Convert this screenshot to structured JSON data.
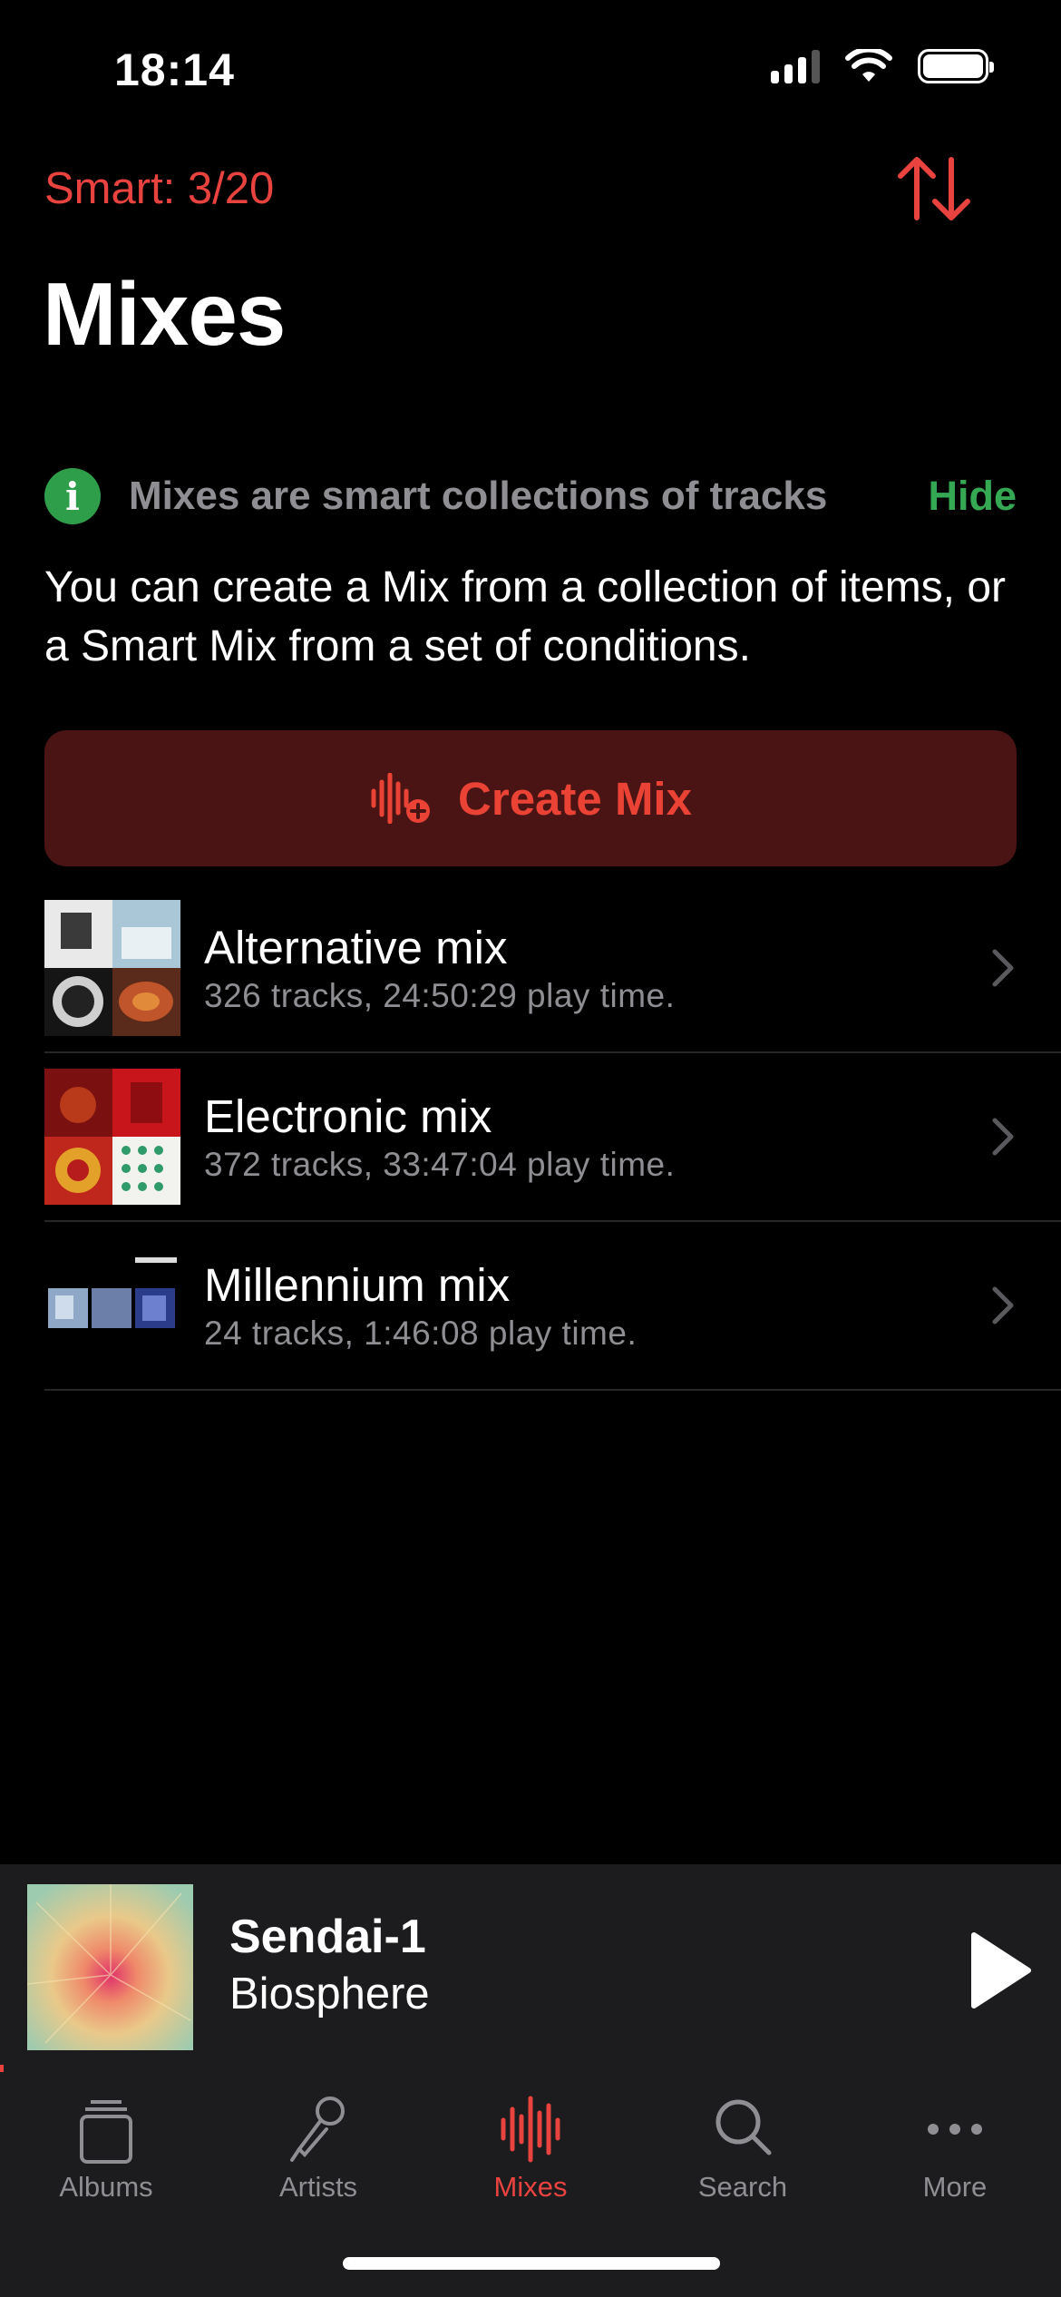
{
  "status_bar": {
    "time": "18:14"
  },
  "header": {
    "smart_count": "Smart: 3/20",
    "title": "Mixes"
  },
  "info": {
    "title": "Mixes are smart collections of tracks",
    "hide_label": "Hide",
    "body": "You can create a Mix from a collection of items, or a Smart Mix from a set of conditions."
  },
  "create_mix": {
    "label": "Create Mix"
  },
  "mixes": [
    {
      "name": "Alternative mix",
      "meta": "326 tracks, 24:50:29 play time."
    },
    {
      "name": "Electronic mix",
      "meta": "372 tracks, 33:47:04 play time."
    },
    {
      "name": "Millennium mix",
      "meta": "24 tracks, 1:46:08 play time."
    }
  ],
  "now_playing": {
    "title": "Sendai-1",
    "artist": "Biosphere"
  },
  "tabs": [
    {
      "label": "Albums",
      "icon": "albums-icon"
    },
    {
      "label": "Artists",
      "icon": "microphone-icon"
    },
    {
      "label": "Mixes",
      "icon": "waveform-icon",
      "active": true
    },
    {
      "label": "Search",
      "icon": "search-icon"
    },
    {
      "label": "More",
      "icon": "ellipsis-icon"
    }
  ],
  "colors": {
    "accent": "#e8433f",
    "info_green": "#34a853",
    "create_bg": "#4a1414",
    "bar_bg": "#1c1c1e"
  }
}
